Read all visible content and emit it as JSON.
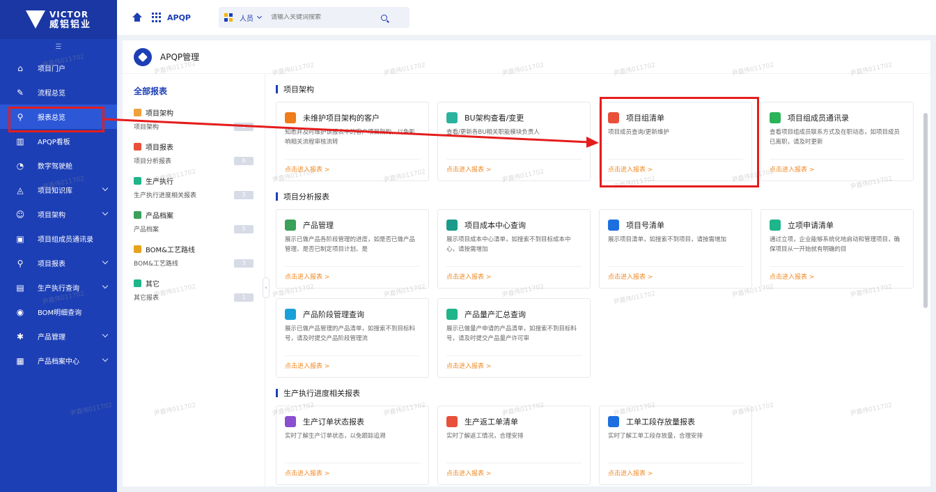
{
  "logo": {
    "line1": "VICTOR",
    "line2": "威铝铝业"
  },
  "sidebar": {
    "collapse_icon": "menu-fold-icon",
    "items": [
      {
        "label": "项目门户",
        "icon": "home-outline-icon",
        "has_children": false
      },
      {
        "label": "流程总览",
        "icon": "edit-icon",
        "has_children": false
      },
      {
        "label": "报表总览",
        "icon": "search-icon",
        "has_children": false,
        "active": true
      },
      {
        "label": "APQP看板",
        "icon": "bar-chart-icon",
        "has_children": false
      },
      {
        "label": "数字驾驶舱",
        "icon": "dashboard-icon",
        "has_children": false
      },
      {
        "label": "项目知识库",
        "icon": "knowledge-icon",
        "has_children": true
      },
      {
        "label": "项目架构",
        "icon": "people-icon",
        "has_children": true
      },
      {
        "label": "项目组成员通讯录",
        "icon": "contacts-icon",
        "has_children": false
      },
      {
        "label": "项目报表",
        "icon": "search-icon",
        "has_children": true
      },
      {
        "label": "生产执行查询",
        "icon": "production-icon",
        "has_children": true
      },
      {
        "label": "BOM明细查询",
        "icon": "bom-icon",
        "has_children": false
      },
      {
        "label": "产品管理",
        "icon": "gear-icon",
        "has_children": true
      },
      {
        "label": "产品档案中心",
        "icon": "archive-icon",
        "has_children": true
      }
    ]
  },
  "topbar": {
    "app_name": "APQP",
    "scope": "人员",
    "search_placeholder": "请输入关键词搜索"
  },
  "main": {
    "title": "APQP管理",
    "all_reports": "全部报表",
    "categories": [
      {
        "name": "项目架构",
        "sub": "项目架构",
        "count": "4",
        "color": "#f0a03c"
      },
      {
        "name": "项目报表",
        "sub": "项目分析报表",
        "count": "6",
        "color": "#e8503a"
      },
      {
        "name": "生产执行",
        "sub": "生产执行进度相关报表",
        "count": "3",
        "color": "#1fb58a"
      },
      {
        "name": "产品档案",
        "sub": "产品档案",
        "count": "5",
        "color": "#3aa05a"
      },
      {
        "name": "BOM&工艺路线",
        "sub": "BOM&工艺路线",
        "count": "3",
        "color": "#e8a21c"
      },
      {
        "name": "其它",
        "sub": "其它报表",
        "count": "1",
        "color": "#1fb58a"
      }
    ],
    "sections": [
      {
        "title": "项目架构",
        "cards": [
          {
            "title": "未维护项目架构的客户",
            "desc": "知悉并及时维护该报表中的客户项目架构，以免影响相关流程审核流转",
            "link": "点击进入报表 >",
            "color": "#f07c1a",
            "icon": "alert-icon"
          },
          {
            "title": "BU架构查看/变更",
            "desc": "查看/更新各BU相关职能模块负责人",
            "link": "点击进入报表 >",
            "color": "#2bb3a0",
            "icon": "image-icon"
          },
          {
            "title": "项目组清单",
            "desc": "项目成员查询/更新维护",
            "link": "点击进入报表 >",
            "color": "#e8503a",
            "icon": "group-icon"
          },
          {
            "title": "项目组成员通讯录",
            "desc": "查看项目组成员联系方式及在职动态，如项目成员已离职，请及时更新",
            "link": "点击进入报表 >",
            "color": "#2bb35a",
            "icon": "address-book-icon"
          }
        ]
      },
      {
        "title": "项目分析报表",
        "cards": [
          {
            "title": "产品管理",
            "desc": "展示已做产品各阶段管理的进度，如是否已做产品管理、是否已制定项目计划、是",
            "link": "点击进入报表 >",
            "color": "#3aa05a",
            "icon": "product-icon"
          },
          {
            "title": "项目成本中心查询",
            "desc": "展示项目成本中心清单，如搜索不到目标成本中心，请按需增加",
            "link": "点击进入报表 >",
            "color": "#1a9a8a",
            "icon": "database-icon"
          },
          {
            "title": "项目号清单",
            "desc": "展示项目清单，如搜索不到项目，请按需增加",
            "link": "点击进入报表 >",
            "color": "#1d6fe0",
            "icon": "link-icon"
          },
          {
            "title": "立项申请清单",
            "desc": "通过立项，企业能够系统化地启动和管理项目，确保项目从一开始就有明确的目",
            "link": "点击进入报表 >",
            "color": "#1fb58a",
            "icon": "apply-icon"
          },
          {
            "title": "产品阶段管理查询",
            "desc": "展示已做产品管理的产品清单，如搜索不到目标料号，请及时提交产品阶段管理流",
            "link": "点击进入报表 >",
            "color": "#1aa0d8",
            "icon": "stage-icon"
          },
          {
            "title": "产品量产汇总查询",
            "desc": "展示已做量产申请的产品清单，如搜索不到目标料号，请及时提交产品量产许可审",
            "link": "点击进入报表 >",
            "color": "#1fb58a",
            "icon": "check-circle-icon"
          }
        ]
      },
      {
        "title": "生产执行进度相关报表",
        "cards": [
          {
            "title": "生产订单状态报表",
            "desc": "实时了解生产订单状态，以免跟踪追溯",
            "link": "点击进入报表 >",
            "color": "#8a4fd0",
            "icon": "order-icon"
          },
          {
            "title": "生产返工单清单",
            "desc": "实时了解返工情况，合理安排",
            "link": "点击进入报表 >",
            "color": "#e8503a",
            "icon": "rework-icon"
          },
          {
            "title": "工单工段存放量报表",
            "desc": "实时了解工单工段存放量，合理安排",
            "link": "点击进入报表 >",
            "color": "#1d6fe0",
            "icon": "storage-icon"
          }
        ]
      }
    ]
  },
  "watermark": "尹嘉伟011702"
}
